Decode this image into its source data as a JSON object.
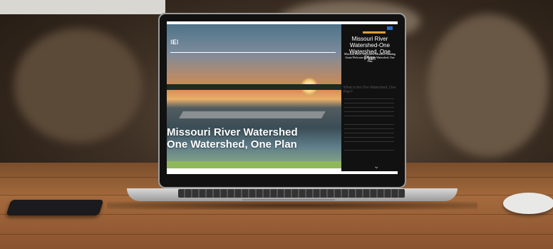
{
  "top_card": {
    "text": ""
  },
  "site": {
    "logo_text": "",
    "hero_title_line1": "Missouri River Watershed",
    "hero_title_line2": "One Watershed, One Plan",
    "panel_title": "Missouri River Watershed-One Watershed, One Plan",
    "panel_subtitle": "Missouri River Watershed Awarded Planning Grant Welcome to the One Watershed, One Plan",
    "panel_section": "What is the One Watershed, One Plan?"
  }
}
